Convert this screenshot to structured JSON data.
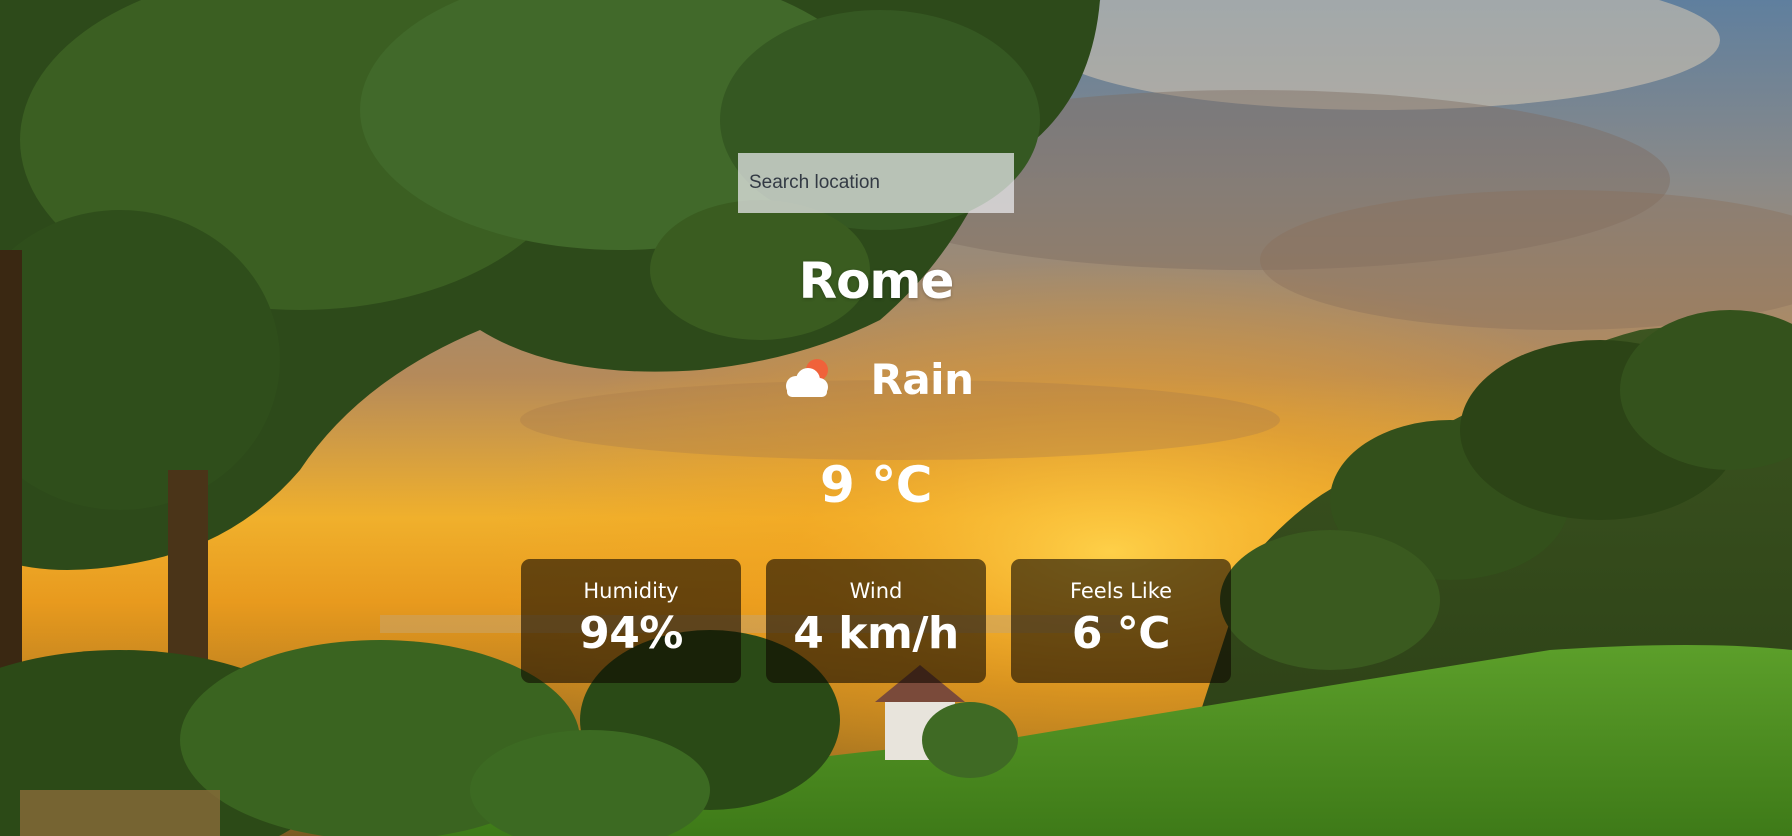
{
  "search": {
    "placeholder": "Search location",
    "value": ""
  },
  "weather": {
    "city": "Rome",
    "condition": "Rain",
    "condition_icon": "cloud-sun-icon",
    "temperature": "9 °C"
  },
  "stats": [
    {
      "label": "Humidity",
      "value": "94%"
    },
    {
      "label": "Wind",
      "value": "4 km/h"
    },
    {
      "label": "Feels Like",
      "value": "6 °C"
    }
  ],
  "background": {
    "subject": "sunset-landscape",
    "colors": {
      "sky_top": "#6f8aa8",
      "sky_glow": "#f3b52a",
      "foliage": "#2f4a1c",
      "grass": "#5aa325"
    }
  }
}
